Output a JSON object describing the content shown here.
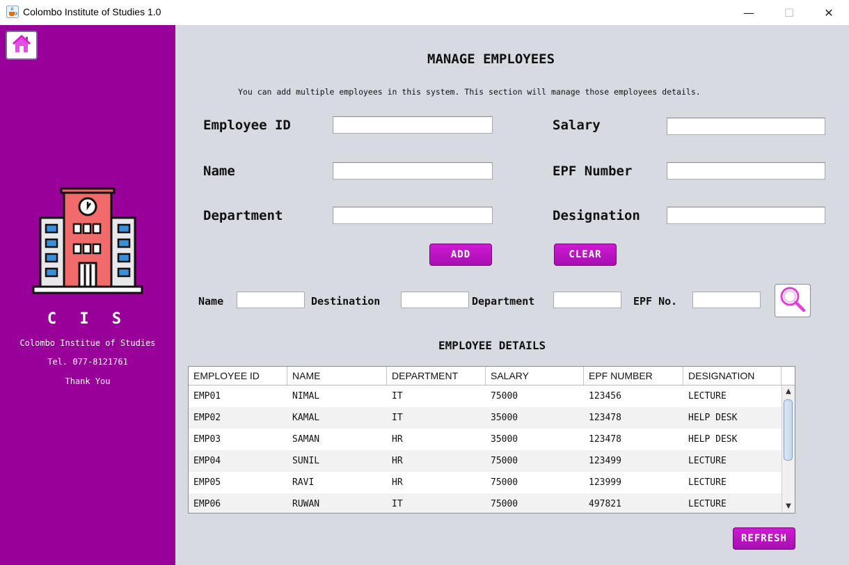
{
  "window": {
    "title": "Colombo Institute of Studies 1.0",
    "icon": "java-cup-icon",
    "minimize": "—",
    "maximize": "☐",
    "close": "✕"
  },
  "sidebar": {
    "home_icon": "home-icon",
    "logo_icon": "building-icon",
    "title": "C I S",
    "org": "Colombo Institue of Studies",
    "tel": "Tel. 077-8121761",
    "thanks": "Thank You",
    "bg_color": "#990099"
  },
  "main": {
    "title": "MANAGE EMPLOYEES",
    "description": "You can add multiple employees in this system. This section will manage those employees details.",
    "form": {
      "employee_id_label": "Employee ID",
      "name_label": "Name",
      "department_label": "Department",
      "salary_label": "Salary",
      "epf_label": "EPF Number",
      "designation_label": "Designation",
      "employee_id_value": "",
      "name_value": "",
      "department_value": "",
      "salary_value": "",
      "epf_value": "",
      "designation_value": ""
    },
    "buttons": {
      "add": "ADD",
      "clear": "CLEAR",
      "refresh": "REFRESH",
      "accent_color": "#c014c8"
    },
    "search": {
      "name_label": "Name",
      "destination_label": "Destination",
      "department_label": "Department",
      "epf_label": "EPF No.",
      "search_icon": "search-icon"
    },
    "table": {
      "title": "EMPLOYEE DETAILS",
      "columns": [
        "EMPLOYEE ID",
        "NAME",
        "DEPARTMENT",
        "SALARY",
        "EPF NUMBER",
        "DESIGNATION"
      ],
      "rows": [
        [
          "EMP01",
          "NIMAL",
          "IT",
          "75000",
          "123456",
          "LECTURE"
        ],
        [
          "EMP02",
          "KAMAL",
          "IT",
          "35000",
          "123478",
          "HELP DESK"
        ],
        [
          "EMP03",
          "SAMAN",
          "HR",
          "35000",
          "123478",
          "HELP DESK"
        ],
        [
          "EMP04",
          "SUNIL",
          "HR",
          "75000",
          "123499",
          "LECTURE"
        ],
        [
          "EMP05",
          "RAVI",
          "HR",
          "75000",
          "123999",
          "LECTURE"
        ],
        [
          "EMP06",
          "RUWAN",
          "IT",
          "75000",
          "497821",
          "LECTURE"
        ]
      ]
    }
  }
}
